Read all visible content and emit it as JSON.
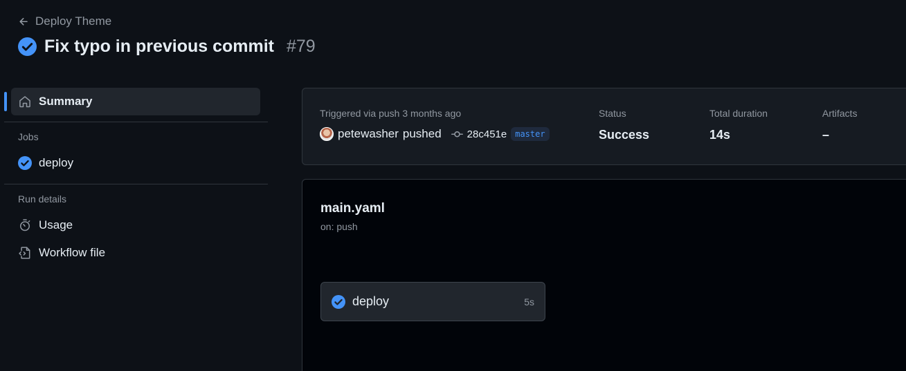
{
  "header": {
    "back_label": "Deploy Theme",
    "title": "Fix typo in previous commit",
    "run_number": "#79",
    "status_icon": "check-circle-icon"
  },
  "sidebar": {
    "summary_label": "Summary",
    "jobs_heading": "Jobs",
    "jobs": [
      {
        "label": "deploy",
        "status": "success"
      }
    ],
    "run_details_heading": "Run details",
    "usage_label": "Usage",
    "workflow_file_label": "Workflow file"
  },
  "summary": {
    "trigger_text": "Triggered via push 3 months ago",
    "actor": "petewasher",
    "action": "pushed",
    "commit_sha": "28c451e",
    "branch": "master",
    "status_label": "Status",
    "status_value": "Success",
    "duration_label": "Total duration",
    "duration_value": "14s",
    "artifacts_label": "Artifacts",
    "artifacts_value": "–"
  },
  "workflow": {
    "file_name": "main.yaml",
    "trigger": "on: push",
    "jobs": [
      {
        "name": "deploy",
        "duration": "5s",
        "status": "success"
      }
    ]
  },
  "colors": {
    "background": "#0d1117",
    "accent": "#4493f8",
    "success_check": "#4493f8",
    "muted_text": "#9198a1"
  }
}
